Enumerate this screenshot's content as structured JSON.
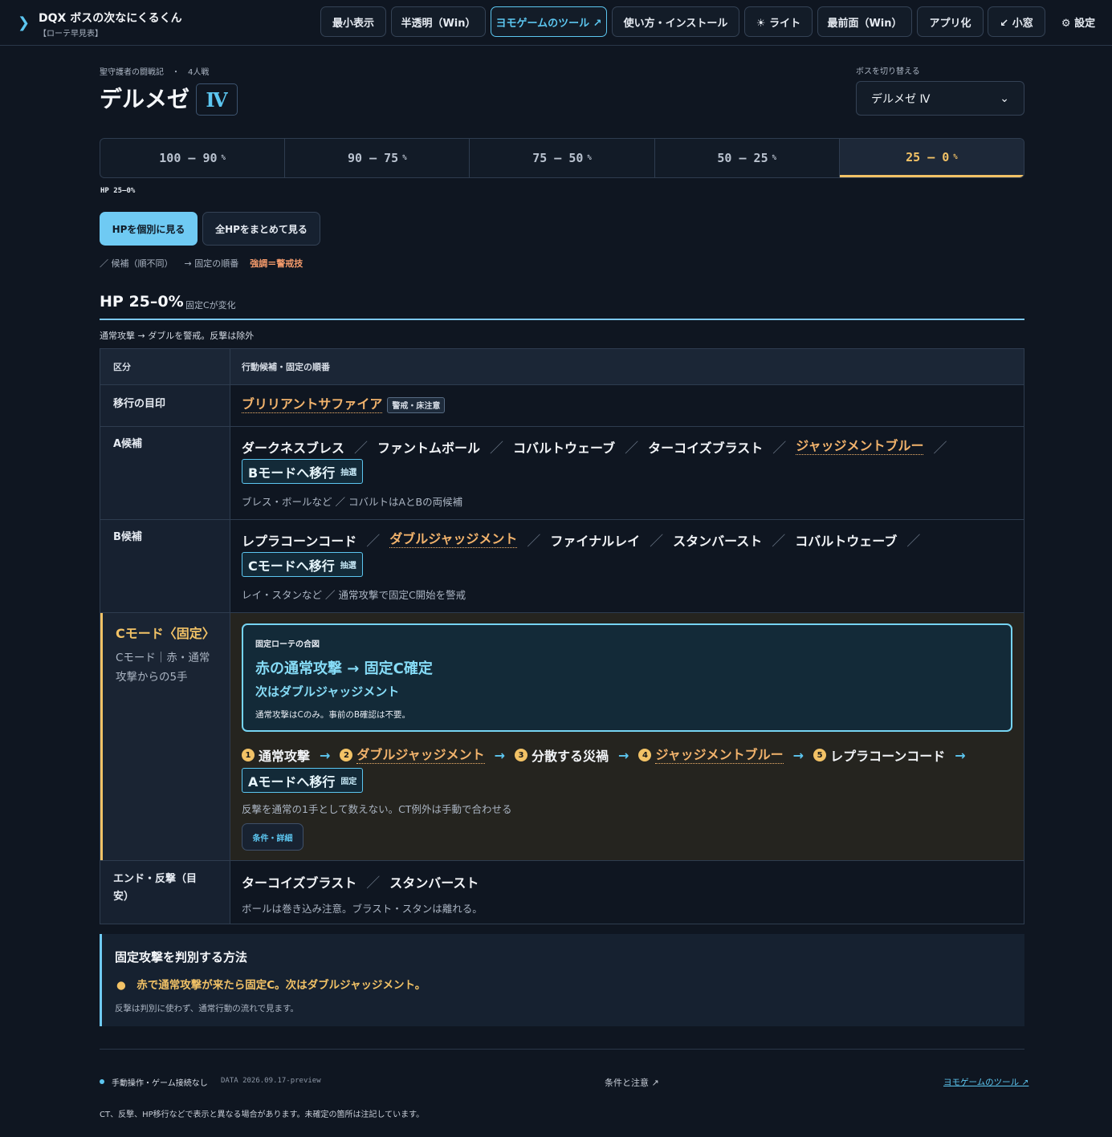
{
  "app": {
    "title": "DQX ボスの次なにくるくん",
    "subtitle": "【ローテ早見表】"
  },
  "nav": {
    "minimal": "最小表示",
    "translucent": "半透明（Win）",
    "tools": "ヨモゲームのツール ↗",
    "howto": "使い方・インストール",
    "light": "☀ ライト",
    "front": "最前面（Win）",
    "app": "アプリ化",
    "small": "↙ 小窓",
    "settings": "⚙ 設定"
  },
  "header": {
    "category": "聖守護者の闘戦記　・　4人戦",
    "boss_name": "デルメゼ",
    "boss_level": "Ⅳ",
    "switch_label": "ボスを切り替える",
    "switch_value": "デルメゼ Ⅳ",
    "switch_arrow": "⌄"
  },
  "tabs": [
    {
      "label": "100 – 90",
      "unit": "%"
    },
    {
      "label": "90 – 75",
      "unit": "%"
    },
    {
      "label": "75 – 50",
      "unit": "%"
    },
    {
      "label": "50 – 25",
      "unit": "%"
    },
    {
      "label": "25 – 0",
      "unit": "%"
    }
  ],
  "active_tab_index": 4,
  "hp_indicator": "HP 25–0%",
  "view": {
    "individual": "HPを個別に見る",
    "all": "全HPをまとめて見る"
  },
  "legend": {
    "candidates": "／ 候補（順不同）",
    "fixed": "→ 固定の順番",
    "warning": "強調＝警戒技"
  },
  "section": {
    "title": "HP 25–0%",
    "note": "固定Cが変化",
    "desc": "通常攻撃 → ダブルを警戒。反撃は除外"
  },
  "table": {
    "head": {
      "col1": "区分",
      "col2": "行動候補・固定の順番"
    },
    "transition": {
      "label": "移行の目印",
      "skill": "ブリリアントサファイア",
      "tag": "警戒・床注意"
    },
    "a": {
      "label": "A候補",
      "skills": [
        "ダークネスブレス",
        "ファントムボール",
        "コバルトウェーブ",
        "ターコイズブラスト",
        "ジャッジメントブルー"
      ],
      "mode": "Bモードへ移行",
      "mode_tag": "抽選",
      "note": "ブレス・ボールなど ／ コバルトはAとBの両候補"
    },
    "b": {
      "label": "B候補",
      "skills": [
        "レプラコーンコード",
        "ダブルジャッジメント",
        "ファイナルレイ",
        "スタンバースト",
        "コバルトウェーブ"
      ],
      "mode": "Cモードへ移行",
      "mode_tag": "抽選",
      "note": "レイ・スタンなど ／ 通常攻撃で固定C開始を警戒"
    },
    "c": {
      "label": "Cモード〈固定〉",
      "label_sub1": "Cモード｜赤・通常",
      "label_sub2": "攻撃からの5手",
      "signal": {
        "caption": "固定ローテの合図",
        "main": "赤の通常攻撃 → 固定C確定",
        "next": "次はダブルジャッジメント",
        "note": "通常攻撃はCのみ。事前のB確認は不要。"
      },
      "steps": [
        {
          "n": "1",
          "name": "通常攻撃"
        },
        {
          "n": "2",
          "name": "ダブルジャッジメント"
        },
        {
          "n": "3",
          "name": "分散する災禍"
        },
        {
          "n": "4",
          "name": "ジャッジメントブルー"
        },
        {
          "n": "5",
          "name": "レプラコーンコード"
        }
      ],
      "mode": "Aモードへ移行",
      "mode_tag": "固定",
      "note": "反撃を通常の1手として数えない。CT例外は手動で合わせる",
      "detail": "条件・詳細"
    },
    "end": {
      "label1": "エンド・反撃（目",
      "label2": "安）",
      "skills": [
        "ターコイズブラスト",
        "スタンバースト"
      ],
      "note": "ボールは巻き込み注意。ブラスト・スタンは離れる。"
    }
  },
  "method": {
    "title": "固定攻撃を判別する方法",
    "item": "●　赤で通常攻撃が来たら固定C。次はダブルジャッジメント。",
    "note": "反撃は判別に使わず、通常行動の流れで見ます。"
  },
  "footer": {
    "status": "手動操作・ゲーム接続なし",
    "data": "DATA 2026.09.17-preview",
    "conditions": "条件と注意 ↗",
    "tools": "ヨモゲームのツール ↗",
    "disclaimer": "CT、反撃、HP移行などで表示と異なる場合があります。未確定の箇所は注記しています。"
  },
  "colors": {
    "accent": "#5cc6f0",
    "warning": "#f2b36c",
    "active": "#f2c266"
  }
}
